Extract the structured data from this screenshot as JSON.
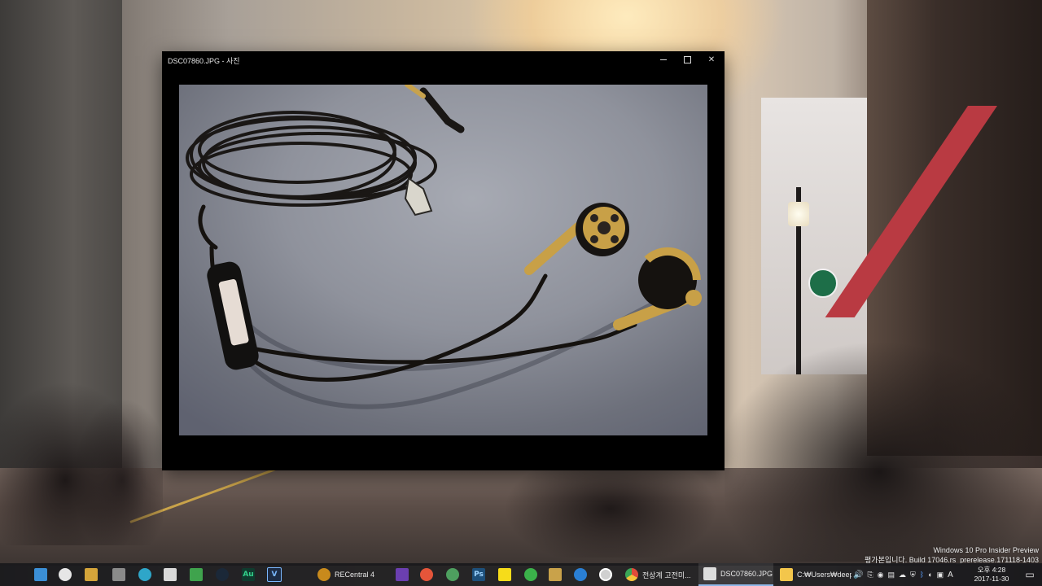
{
  "window": {
    "title": "DSC07860.JPG - 사진",
    "controls": {
      "minimize": "minimize",
      "maximize": "maximize",
      "close": "✕"
    }
  },
  "watermark": {
    "line1": "Windows 10 Pro Insider Preview",
    "line2": "평가본입니다. Build 17046.rs_prerelease.171118-1403"
  },
  "taskbar": {
    "pinned": [
      {
        "name": "start-icon",
        "glyph": ""
      },
      {
        "name": "task-view-icon",
        "glyph": ""
      },
      {
        "name": "generic-app-icon",
        "glyph": ""
      },
      {
        "name": "photos-app-icon",
        "glyph": ""
      },
      {
        "name": "tool-icon",
        "glyph": ""
      },
      {
        "name": "edge-alt-icon",
        "glyph": ""
      },
      {
        "name": "calculator-icon",
        "glyph": ""
      },
      {
        "name": "image-viewer-icon",
        "glyph": ""
      },
      {
        "name": "steam-icon",
        "glyph": ""
      },
      {
        "name": "audition-icon",
        "glyph": "Au"
      },
      {
        "name": "vegas-icon",
        "glyph": "V"
      }
    ],
    "apps": [
      {
        "name": "recentral-app",
        "label": "RECentral 4",
        "color": "#c88a1c"
      },
      {
        "name": "app-purple",
        "label": "",
        "color": "#6b3fb0"
      },
      {
        "name": "app-red",
        "label": "",
        "color": "#e5553a"
      },
      {
        "name": "app-green-ball",
        "label": "",
        "color": "#4e9f5f"
      },
      {
        "name": "photoshop-app",
        "label": "",
        "color": "#1d4f7a"
      },
      {
        "name": "kakaotalk-app",
        "label": "",
        "color": "#f6dc1a"
      },
      {
        "name": "app-green",
        "label": "",
        "color": "#3bb24a"
      },
      {
        "name": "app-gold",
        "label": "",
        "color": "#c9a24a"
      },
      {
        "name": "edge-app",
        "label": "",
        "color": "#2a7fd4"
      },
      {
        "name": "app-disc",
        "label": "",
        "color": "#d0d0d0"
      },
      {
        "name": "chrome-app",
        "label": "전상계 고전미...",
        "color": "#e04a3a"
      },
      {
        "name": "photos-window-app",
        "label": "DSC07860.JPG ...",
        "color": "#dddddd"
      },
      {
        "name": "explorer-app",
        "label": "C:₩Users₩deepl...",
        "color": "#f3c64b"
      }
    ],
    "clock": {
      "time": "오후 4:28",
      "date": "2017-11-30"
    },
    "ime": "A",
    "colors": {
      "accent": "#8fb7e8",
      "background": "#19191c"
    }
  }
}
